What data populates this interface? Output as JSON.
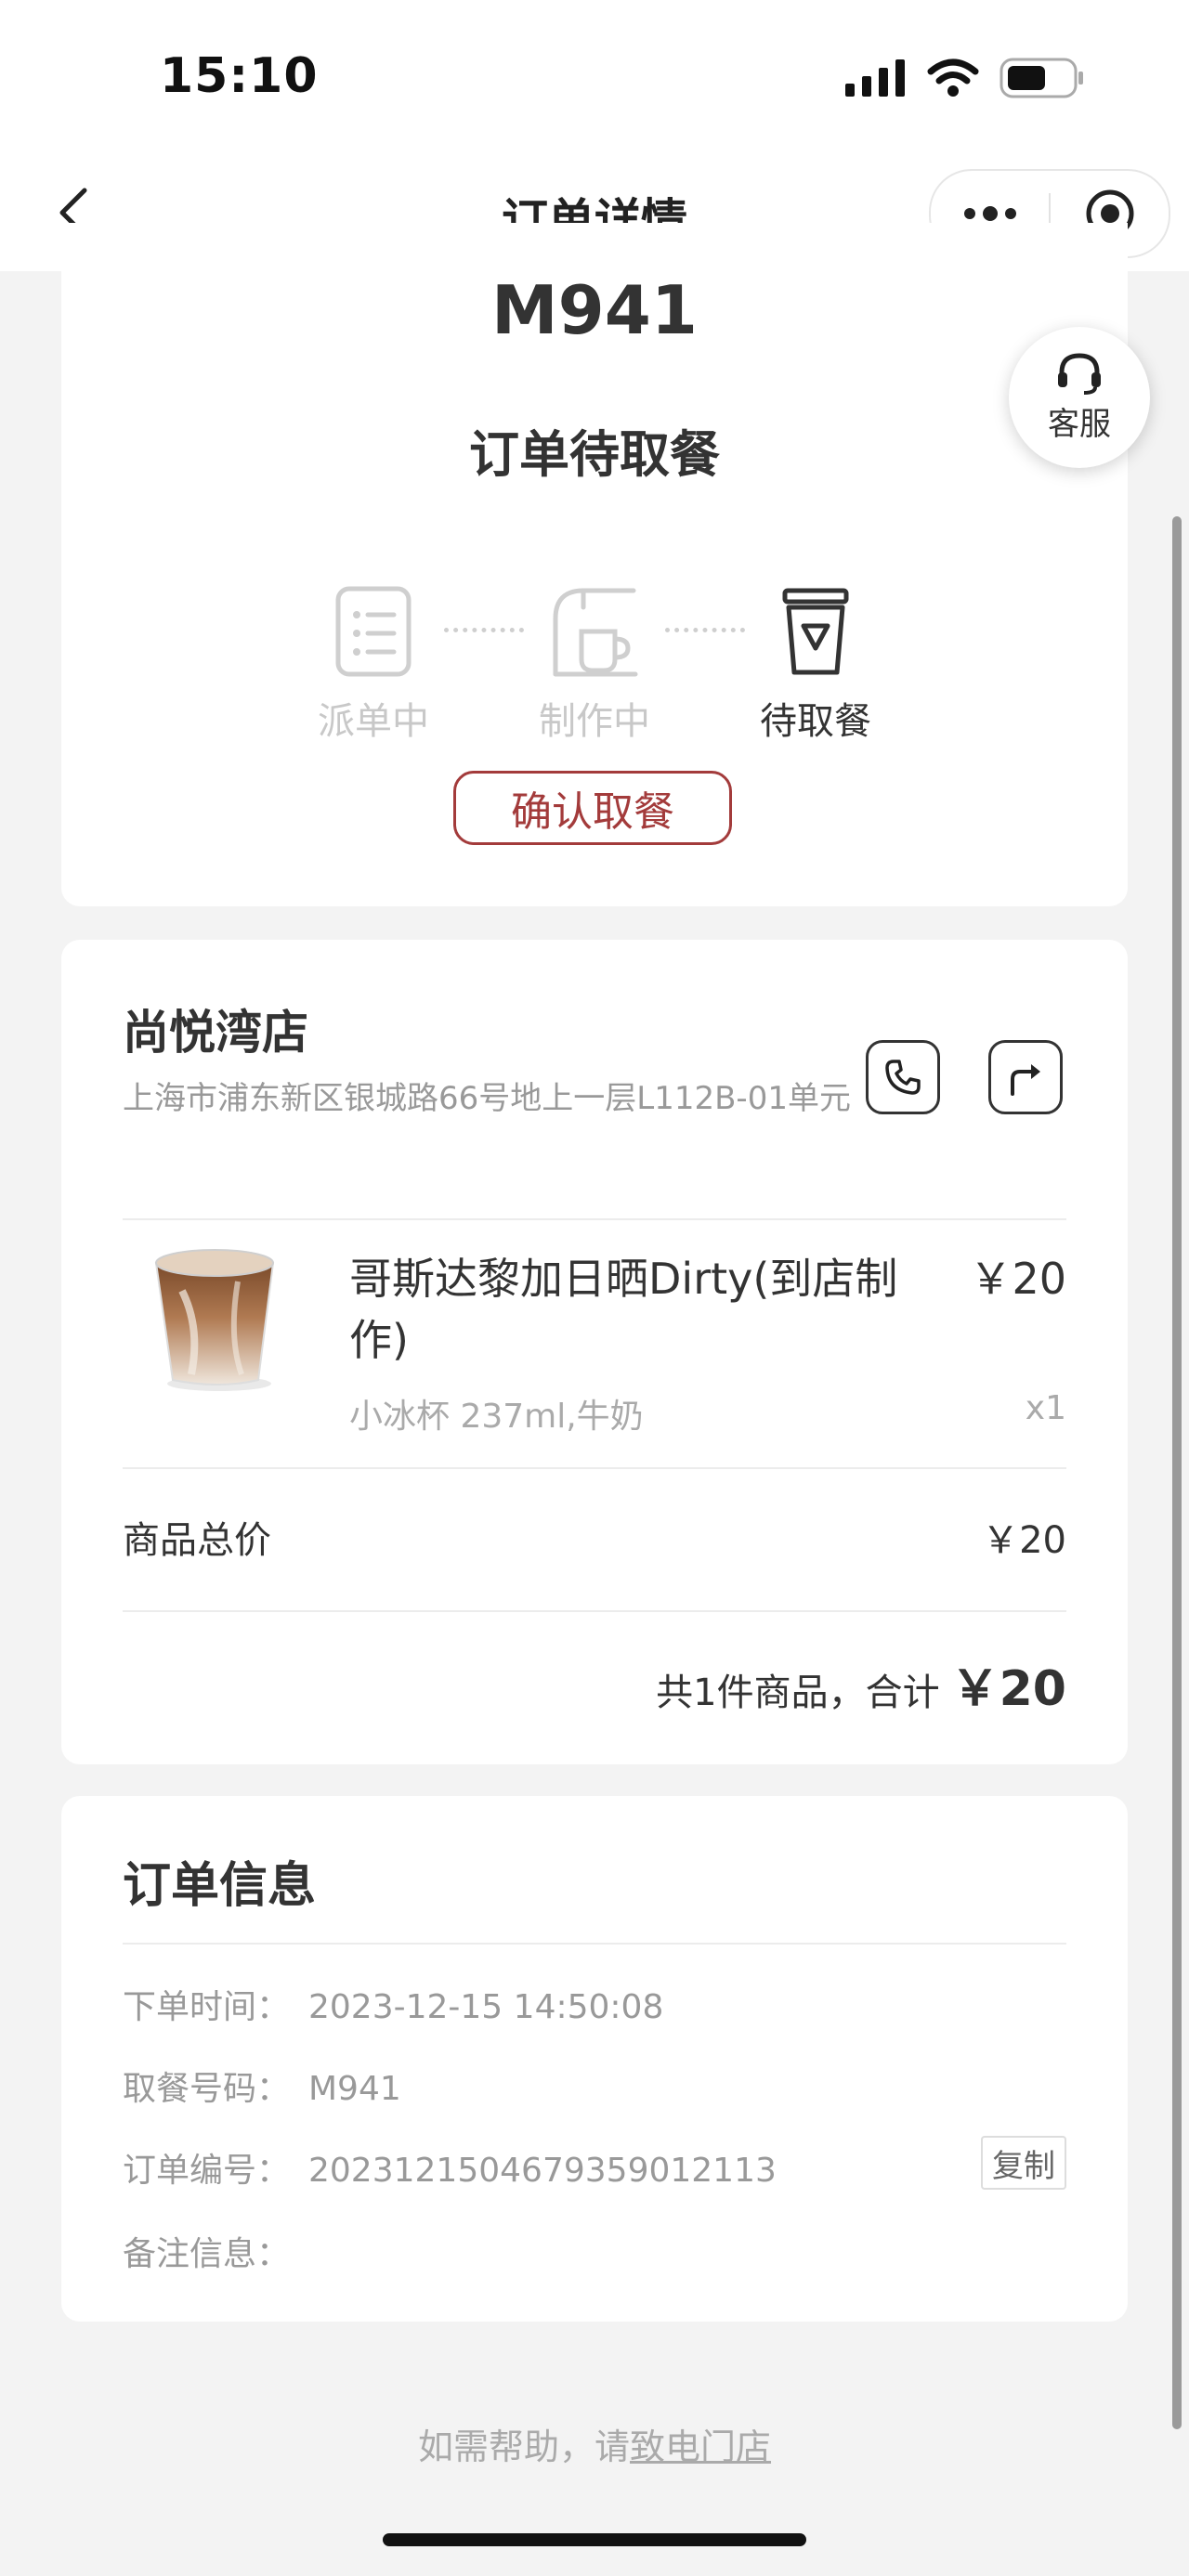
{
  "status_bar": {
    "time": "15:10"
  },
  "nav": {
    "title": "订单详情"
  },
  "order_status": {
    "pickup_code": "M941",
    "status_text": "订单待取餐",
    "steps": [
      {
        "label": "派单中",
        "active": false
      },
      {
        "label": "制作中",
        "active": false
      },
      {
        "label": "待取餐",
        "active": true
      }
    ],
    "confirm_label": "确认取餐"
  },
  "help_fab": {
    "label": "客服"
  },
  "store": {
    "name": "尚悦湾店",
    "address": "上海市浦东新区银城路66号地上一层L112B-01单元"
  },
  "product": {
    "name": "哥斯达黎加日晒Dirty(到店制作)",
    "price": "￥20",
    "spec": "小冰杯 237ml,牛奶",
    "qty": "x1"
  },
  "summary": {
    "subtotal_label": "商品总价",
    "subtotal_value": "￥20",
    "total_prefix": "共1件商品，合计",
    "total_amount": "￥20"
  },
  "order_info": {
    "title": "订单信息",
    "rows": [
      {
        "label": "下单时间：",
        "value": "2023-12-15 14:50:08"
      },
      {
        "label": "取餐号码：",
        "value": "M941"
      },
      {
        "label": "订单编号：",
        "value": "20231215046793590121​13"
      },
      {
        "label": "备注信息：",
        "value": ""
      }
    ],
    "copy_label": "复制"
  },
  "footer": {
    "help_prefix": "如需帮助，请",
    "help_link": "致电门店"
  },
  "colors": {
    "accent": "#a33b3b",
    "background": "#f3f3f3",
    "muted": "#999999"
  }
}
